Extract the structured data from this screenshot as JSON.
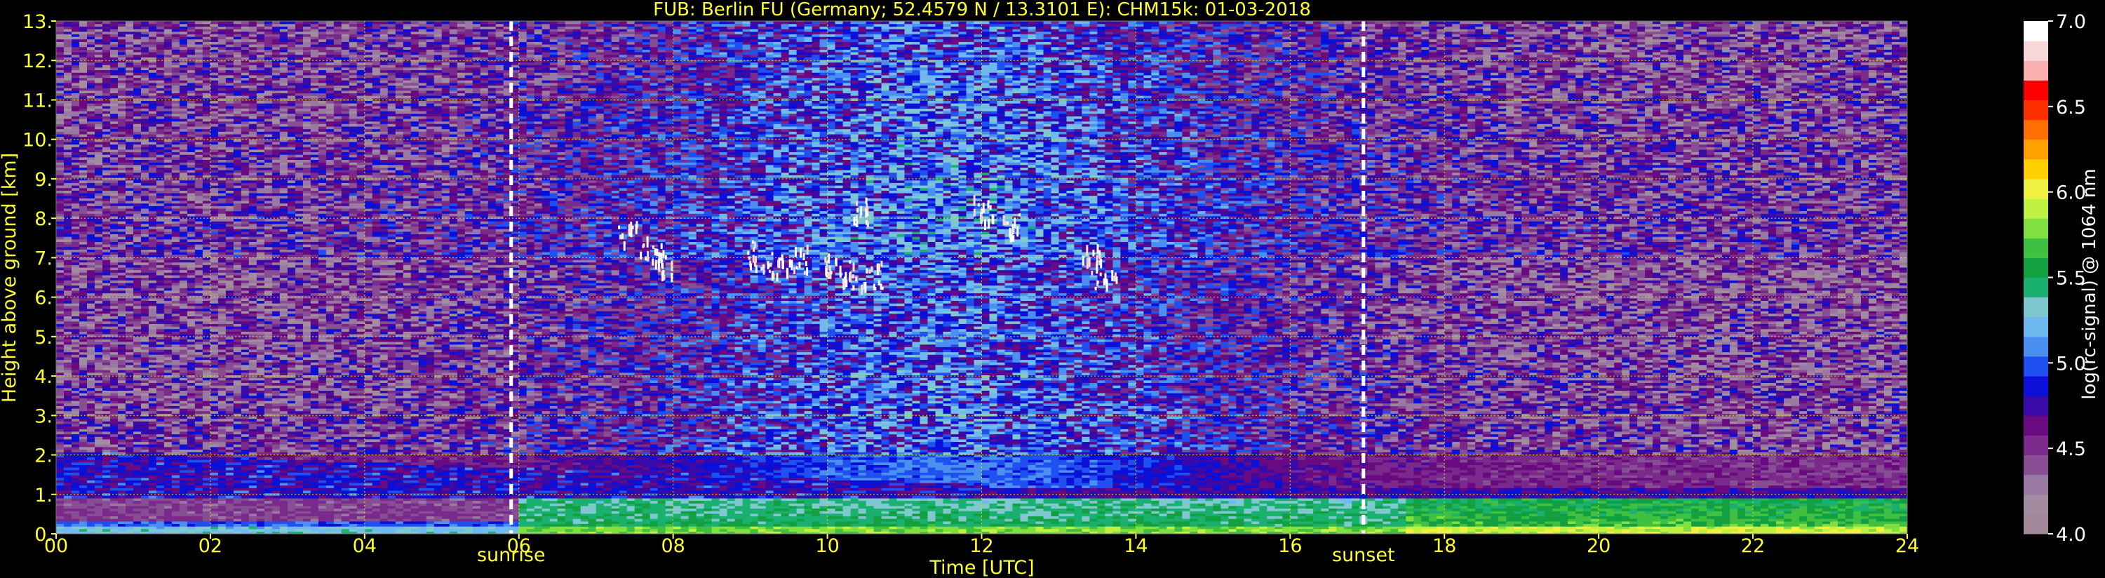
{
  "chart_data": {
    "type": "heatmap",
    "title": "FUB: Berlin FU (Germany; 52.4579 N / 13.3101 E):    CHM15k: 01-03-2018",
    "xlabel": "Time [UTC]",
    "ylabel": "Height above ground [km]",
    "xlim": [
      0,
      24
    ],
    "ylim": [
      0,
      13
    ],
    "x_ticks": [
      0,
      2,
      4,
      6,
      8,
      10,
      12,
      14,
      16,
      18,
      20,
      22,
      24
    ],
    "x_tick_labels": [
      "00",
      "02",
      "04",
      "06",
      "08",
      "10",
      "12",
      "14",
      "16",
      "18",
      "20",
      "22",
      "24"
    ],
    "y_ticks": [
      0,
      1,
      2,
      3,
      4,
      5,
      6,
      7,
      8,
      9,
      10,
      11,
      12,
      13
    ],
    "y_tick_labels": [
      "0.",
      "1.",
      "2.",
      "3.",
      "4.",
      "5.",
      "6.",
      "7.",
      "8.",
      "9.",
      "10.",
      "11.",
      "12.",
      "13."
    ],
    "grid": true,
    "annotations": [
      {
        "label": "sunrise",
        "x": 5.9
      },
      {
        "label": "sunset",
        "x": 16.95
      }
    ],
    "colorbar": {
      "label": "log(rc-signal) @ 1064 nm",
      "range": [
        4.0,
        7.0
      ],
      "ticks": [
        4.0,
        4.5,
        5.0,
        5.5,
        6.0,
        6.5,
        7.0
      ],
      "tick_labels": [
        "4.0",
        "4.5",
        "5.0",
        "5.5",
        "6.0",
        "6.5",
        "7.0"
      ],
      "colors": [
        "#a08898",
        "#a28ca0",
        "#9a78a4",
        "#884e94",
        "#7a2a8a",
        "#6a0a80",
        "#3a0aa8",
        "#0a10d8",
        "#2050f0",
        "#4a90f0",
        "#70b8f0",
        "#80c8d0",
        "#1ab070",
        "#12a040",
        "#40c040",
        "#80e040",
        "#c0f040",
        "#f0f040",
        "#ffd000",
        "#ffa000",
        "#ff7000",
        "#ff3000",
        "#ff0000",
        "#f8b0b0",
        "#f8d8d8",
        "#ffffff"
      ]
    },
    "layers": [
      {
        "name": "surface aerosol layer",
        "x": [
          0,
          24
        ],
        "height_km": [
          0.0,
          0.9
        ],
        "approx_value": 5.5
      },
      {
        "name": "residual layer",
        "x": [
          0,
          12
        ],
        "height_km": [
          1.0,
          2.1
        ],
        "approx_value": 4.8
      },
      {
        "name": "cirrus patches",
        "x": [
          7.3,
          13.6
        ],
        "height_km": [
          6.5,
          8.5
        ],
        "approx_value": 7.0
      }
    ]
  }
}
